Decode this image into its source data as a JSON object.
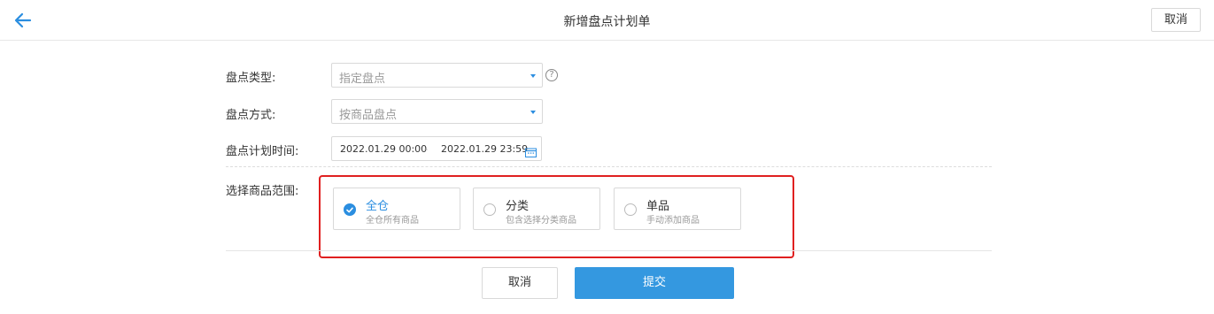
{
  "header": {
    "title": "新增盘点计划单",
    "cancel_label": "取消",
    "back_icon": "arrow-left-icon"
  },
  "form": {
    "type": {
      "label": "盘点类型:",
      "value": "指定盘点"
    },
    "method": {
      "label": "盘点方式:",
      "value": "按商品盘点"
    },
    "time": {
      "label": "盘点计划时间:",
      "start": "2022.01.29 00:00",
      "separator": "-",
      "end": "2022.01.29 23:59"
    },
    "scope": {
      "label": "选择商品范围:",
      "options": [
        {
          "title": "全仓",
          "desc": "全仓所有商品",
          "checked": true
        },
        {
          "title": "分类",
          "desc": "包含选择分类商品",
          "checked": false
        },
        {
          "title": "单品",
          "desc": "手动添加商品",
          "checked": false
        }
      ]
    }
  },
  "actions": {
    "cancel_label": "取消",
    "submit_label": "提交"
  },
  "colors": {
    "accent": "#2b8ee0",
    "submit": "#3498e0",
    "highlight": "#e02020"
  }
}
